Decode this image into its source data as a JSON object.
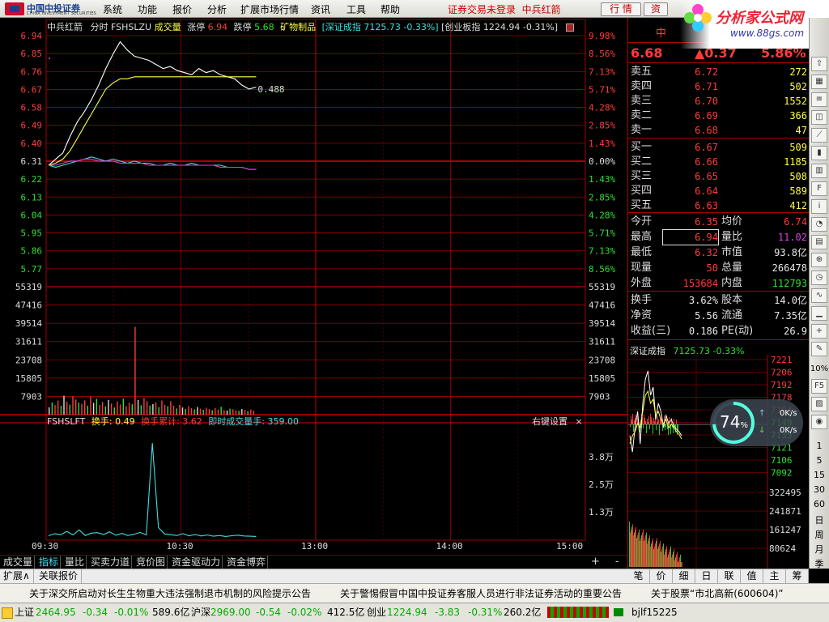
{
  "menu": {
    "logo_cn": "中国中投证券",
    "logo_en": "CHINA INVESTMENT SECURITIES",
    "items": [
      "系统",
      "功能",
      "报价",
      "分析",
      "扩展市场行情",
      "资讯",
      "工具",
      "帮助"
    ],
    "login_status": "证券交易未登录",
    "stock_name": "中兵红箭",
    "quote_btn": "行 情",
    "trade_btn": "资"
  },
  "promo": {
    "title": "分析家公式网",
    "url": "www.88gs.com"
  },
  "chart_header": {
    "name": "中兵红箭",
    "mode": "分时",
    "code": "FSHSLZU",
    "vol_label": "成交量",
    "up_label": "涨停",
    "up_val": "6.94",
    "down_label": "跌停",
    "down_val": "5.68",
    "sector": "矿物制品",
    "index1": "[深证成指 7125.73 -0.33%]",
    "index2": "[创业板指 1224.94 -0.31%]"
  },
  "chart_data": [
    {
      "type": "line",
      "title": "分时",
      "y_left_ticks": [
        "6.94",
        "6.85",
        "6.76",
        "6.67",
        "6.58",
        "6.49",
        "6.40",
        "6.31",
        "6.22",
        "6.13",
        "6.04",
        "5.95",
        "5.86",
        "5.77"
      ],
      "y_right_ticks": [
        "9.98%",
        "8.56%",
        "7.13%",
        "5.71%",
        "4.28%",
        "2.85%",
        "1.43%",
        "0.00%",
        "1.43%",
        "2.85%",
        "4.28%",
        "5.71%",
        "7.13%",
        "8.56%"
      ],
      "prev_close": 6.31,
      "ylim": [
        5.68,
        6.94
      ],
      "annotation": "0.488",
      "series": [
        {
          "name": "price",
          "color": "#ffffff",
          "values": [
            6.31,
            6.34,
            6.37,
            6.45,
            6.52,
            6.57,
            6.63,
            6.7,
            6.78,
            6.85,
            6.91,
            6.87,
            6.84,
            6.83,
            6.82,
            6.8,
            6.78,
            6.79,
            6.77,
            6.76,
            6.75,
            6.78,
            6.76,
            6.77,
            6.75,
            6.74,
            6.73,
            6.7,
            6.68,
            6.69
          ]
        },
        {
          "name": "avg",
          "color": "#ffff40",
          "values": [
            6.31,
            6.32,
            6.34,
            6.38,
            6.44,
            6.5,
            6.56,
            6.62,
            6.68,
            6.71,
            6.73,
            6.73,
            6.74,
            6.74,
            6.74,
            6.74,
            6.74,
            6.74,
            6.74,
            6.74,
            6.74,
            6.74,
            6.74,
            6.74,
            6.74,
            6.74,
            6.74,
            6.74,
            6.74,
            6.74
          ]
        },
        {
          "name": "index",
          "color": "#40e0e0",
          "values": [
            6.31,
            6.3,
            6.31,
            6.32,
            6.33,
            6.34,
            6.35,
            6.34,
            6.33,
            6.34,
            6.33,
            6.32,
            6.33,
            6.32,
            6.32,
            6.31,
            6.31,
            6.32,
            6.31,
            6.31,
            6.32,
            6.31,
            6.31,
            6.31,
            6.31,
            6.3,
            6.3,
            6.3,
            6.29,
            6.29
          ]
        },
        {
          "name": "index2",
          "color": "#e040e0",
          "values": [
            6.31,
            6.31,
            6.32,
            6.33,
            6.33,
            6.34,
            6.34,
            6.33,
            6.33,
            6.33,
            6.32,
            6.32,
            6.32,
            6.32,
            6.31,
            6.31,
            6.31,
            6.31,
            6.31,
            6.31,
            6.31,
            6.31,
            6.31,
            6.31,
            6.3,
            6.3,
            6.3,
            6.3,
            6.29,
            6.29
          ]
        }
      ]
    },
    {
      "type": "bar",
      "title": "成交量",
      "y_ticks": [
        "55319",
        "47416",
        "39514",
        "31611",
        "23708",
        "15805",
        "7903"
      ],
      "ylim": [
        0,
        55319
      ],
      "values": [
        3200,
        5200,
        4100,
        6100,
        3800,
        8200,
        5600,
        4300,
        7900,
        6500,
        5200,
        4700,
        6200,
        3900,
        7800,
        5100,
        6800,
        4200,
        5500,
        3600,
        6400,
        4800,
        3100,
        5700,
        4400,
        6900,
        3700,
        5200,
        4500,
        38000,
        6300,
        4100,
        7200,
        5800,
        3900,
        4600,
        5300,
        3300,
        6100,
        4200,
        3600,
        5800,
        3900,
        2700,
        4200,
        3100,
        2500,
        3600,
        2800,
        2300,
        3300,
        2600,
        2100,
        3000,
        2400,
        1900,
        2800,
        2200,
        3400,
        2000,
        1800,
        2600,
        2300,
        1900,
        1600,
        2400,
        2100,
        1500,
        2200,
        1700
      ]
    },
    {
      "type": "line",
      "title": "FSHSLFT",
      "y_ticks": [
        "3.8万",
        "2.5万",
        "1.3万"
      ],
      "series": [
        {
          "name": "即时成交量手",
          "color": "#40e0e0",
          "values": [
            800,
            1600,
            1200,
            2500,
            1100,
            3100,
            900,
            1800,
            2000,
            1300,
            2300,
            1000,
            1700,
            900,
            1400,
            2100,
            1100,
            37000,
            4000,
            1500,
            1200,
            900,
            1600,
            800,
            1300,
            700,
            1100,
            600,
            900,
            500,
            800,
            1000,
            700,
            600,
            500
          ]
        }
      ]
    }
  ],
  "x_ticks": [
    "09:30",
    "10:30",
    "13:00",
    "14:00",
    "15:00"
  ],
  "sub_header": {
    "code": "FSHSLFT",
    "turnover_label": "换手:",
    "turnover_val": "0.49",
    "cum_label": "换手累计:",
    "cum_val": "3.62",
    "instant_label": "即时成交量手:",
    "instant_val": "359.00",
    "right_menu": "右键设置",
    "close": "×"
  },
  "quote": {
    "title": "中",
    "price": "6.68",
    "change": "▲0.37",
    "pct": "5.86%",
    "asks": [
      {
        "label": "卖五",
        "price": "6.72",
        "vol": "272"
      },
      {
        "label": "卖四",
        "price": "6.71",
        "vol": "502"
      },
      {
        "label": "卖三",
        "price": "6.70",
        "vol": "1552"
      },
      {
        "label": "卖二",
        "price": "6.69",
        "vol": "366"
      },
      {
        "label": "卖一",
        "price": "6.68",
        "vol": "47"
      }
    ],
    "bids": [
      {
        "label": "买一",
        "price": "6.67",
        "vol": "509"
      },
      {
        "label": "买二",
        "price": "6.66",
        "vol": "1185"
      },
      {
        "label": "买三",
        "price": "6.65",
        "vol": "508"
      },
      {
        "label": "买四",
        "price": "6.64",
        "vol": "589"
      },
      {
        "label": "买五",
        "price": "6.63",
        "vol": "412"
      }
    ],
    "stats": [
      {
        "l1": "今开",
        "v1": "6.35",
        "l2": "均价",
        "v2": "6.74"
      },
      {
        "l1": "最高",
        "v1": "6.94",
        "l2": "量比",
        "v2": "11.02"
      },
      {
        "l1": "最低",
        "v1": "6.32",
        "l2": "市值",
        "v2": "93.8亿"
      },
      {
        "l1": "现量",
        "v1": "50",
        "l2": "总量",
        "v2": "266478"
      },
      {
        "l1": "外盘",
        "v1": "153684",
        "l2": "内盘",
        "v2": "112793"
      }
    ],
    "stats2": [
      {
        "l1": "换手",
        "v1": "3.62%",
        "l2": "股本",
        "v2": "14.0亿"
      },
      {
        "l1": "净资",
        "v1": "5.56",
        "l2": "流通",
        "v2": "7.35亿"
      },
      {
        "l1": "收益(三)",
        "v1": "0.186",
        "l2": "PE(动)",
        "v2": "26.9"
      }
    ]
  },
  "mini_chart": {
    "title": "深证成指",
    "value": "7125.73",
    "pct": "-0.33%",
    "y_ticks": [
      "7221",
      "7206",
      "7192",
      "7178",
      "7164",
      "7149",
      "7135",
      "7121",
      "7106",
      "7092"
    ],
    "vol_ticks": [
      "322495",
      "241871",
      "161247",
      "80624"
    ],
    "x_ticks": [
      "10%",
      "15",
      "30",
      "60",
      "日",
      "周",
      "月"
    ]
  },
  "gauge": {
    "pct": "74",
    "unit": "%",
    "up": "0K/s",
    "down": "0K/s"
  },
  "bottom_tabs": [
    "成交量",
    "指标",
    "量比",
    "买卖力道",
    "竞价图",
    "资金驱动力",
    "资金博弈"
  ],
  "expand_tabs": [
    "扩展∧",
    "关联报价"
  ],
  "rp_tabs": [
    "笔",
    "价",
    "细",
    "日",
    "联",
    "值",
    "主",
    "筹"
  ],
  "news": "关于深交所启动对长生生物重大违法强制退市机制的风险提示公告　　　关于警惕假冒中国中投证券客服人员进行非法证券活动的重要公告　　　关于股票“市北高新(600604)”",
  "status": {
    "sh_label": "上证",
    "sh_val": "2464.95",
    "sh_chg": "-0.34",
    "sh_pct": "-0.01%",
    "sh_amt": "589.6亿",
    "sz_label": "沪深",
    "sz_val": "2969.00",
    "sz_chg": "-0.54",
    "sz_pct": "-0.02%",
    "sz_amt": "412.5亿",
    "cy_label": "创业",
    "cy_val": "1224.94",
    "cy_chg": "-3.83",
    "cy_pct": "-0.31%",
    "cy_amt": "260.2亿",
    "user": "bjlf15225"
  },
  "toolbar_right": [
    "1",
    "5",
    "15",
    "30",
    "60",
    "日",
    "周",
    "月",
    "季",
    "年"
  ]
}
